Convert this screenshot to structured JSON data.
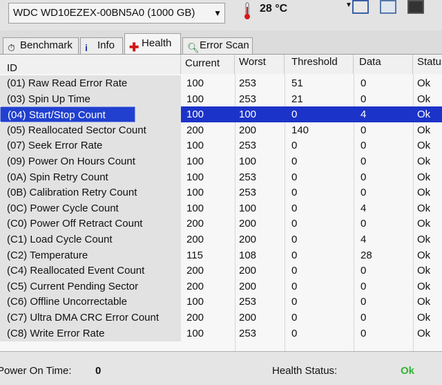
{
  "drive": {
    "selected": "WDC WD10EZEX-00BN5A0 (1000 GB)"
  },
  "temperature": {
    "value": "28 °C"
  },
  "tabs": [
    {
      "label": "Benchmark",
      "icon": "stopwatch-icon"
    },
    {
      "label": "Info",
      "icon": "info-icon"
    },
    {
      "label": "Health",
      "icon": "health-cross-icon"
    },
    {
      "label": "Error Scan",
      "icon": "magnifier-icon"
    }
  ],
  "table": {
    "headers": {
      "id": "ID",
      "current": "Current",
      "worst": "Worst",
      "threshold": "Threshold",
      "data": "Data",
      "status": "Status"
    },
    "rows": [
      {
        "id": "(01) Raw Read Error Rate",
        "current": "100",
        "worst": "253",
        "threshold": "51",
        "data": "0",
        "status": "Ok"
      },
      {
        "id": "(03) Spin Up Time",
        "current": "100",
        "worst": "253",
        "threshold": "21",
        "data": "0",
        "status": "Ok"
      },
      {
        "id": "(04) Start/Stop Count",
        "current": "100",
        "worst": "100",
        "threshold": "0",
        "data": "4",
        "status": "Ok"
      },
      {
        "id": "(05) Reallocated Sector Count",
        "current": "200",
        "worst": "200",
        "threshold": "140",
        "data": "0",
        "status": "Ok"
      },
      {
        "id": "(07) Seek Error Rate",
        "current": "100",
        "worst": "253",
        "threshold": "0",
        "data": "0",
        "status": "Ok"
      },
      {
        "id": "(09) Power On Hours Count",
        "current": "100",
        "worst": "100",
        "threshold": "0",
        "data": "0",
        "status": "Ok"
      },
      {
        "id": "(0A) Spin Retry Count",
        "current": "100",
        "worst": "253",
        "threshold": "0",
        "data": "0",
        "status": "Ok"
      },
      {
        "id": "(0B) Calibration Retry Count",
        "current": "100",
        "worst": "253",
        "threshold": "0",
        "data": "0",
        "status": "Ok"
      },
      {
        "id": "(0C) Power Cycle Count",
        "current": "100",
        "worst": "100",
        "threshold": "0",
        "data": "4",
        "status": "Ok"
      },
      {
        "id": "(C0) Power Off Retract Count",
        "current": "200",
        "worst": "200",
        "threshold": "0",
        "data": "0",
        "status": "Ok"
      },
      {
        "id": "(C1) Load Cycle Count",
        "current": "200",
        "worst": "200",
        "threshold": "0",
        "data": "4",
        "status": "Ok"
      },
      {
        "id": "(C2) Temperature",
        "current": "115",
        "worst": "108",
        "threshold": "0",
        "data": "28",
        "status": "Ok"
      },
      {
        "id": "(C4) Reallocated Event Count",
        "current": "200",
        "worst": "200",
        "threshold": "0",
        "data": "0",
        "status": "Ok"
      },
      {
        "id": "(C5) Current Pending Sector",
        "current": "200",
        "worst": "200",
        "threshold": "0",
        "data": "0",
        "status": "Ok"
      },
      {
        "id": "(C6) Offline Uncorrectable",
        "current": "100",
        "worst": "253",
        "threshold": "0",
        "data": "0",
        "status": "Ok"
      },
      {
        "id": "(C7) Ultra DMA CRC Error Count",
        "current": "200",
        "worst": "200",
        "threshold": "0",
        "data": "0",
        "status": "Ok"
      },
      {
        "id": "(C8) Write Error Rate",
        "current": "100",
        "worst": "253",
        "threshold": "0",
        "data": "0",
        "status": "Ok"
      }
    ]
  },
  "footer": {
    "power_on_label": "Power On Time:",
    "power_on_value": "0",
    "health_label": "Health Status:",
    "health_value": "Ok"
  },
  "colors": {
    "selection": "#1c33c9",
    "health_ok": "#2fb52f",
    "health_icon": "#d01818"
  }
}
